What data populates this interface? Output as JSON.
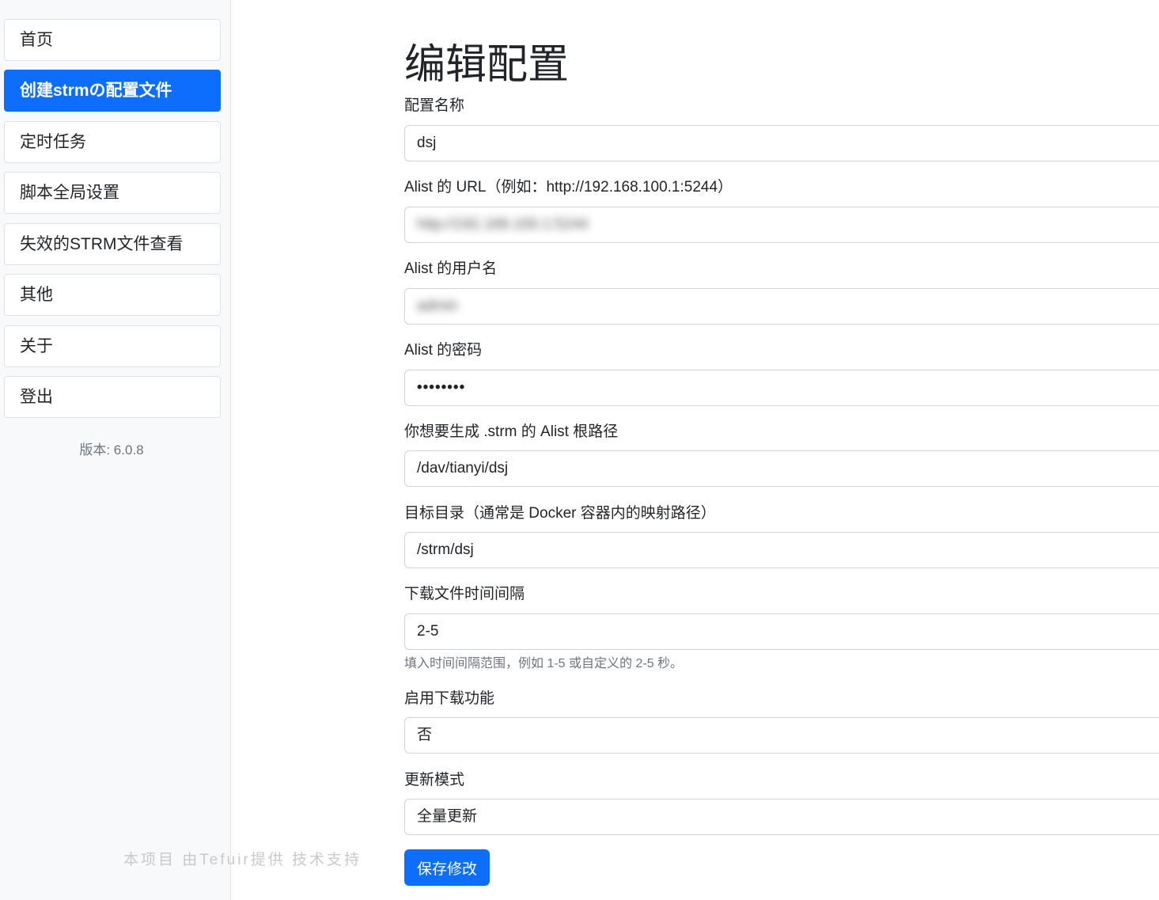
{
  "sidebar": {
    "items": [
      {
        "label": "首页",
        "active": false
      },
      {
        "label": "创建strmの配置文件",
        "active": true
      },
      {
        "label": "定时任务",
        "active": false
      },
      {
        "label": "脚本全局设置",
        "active": false
      },
      {
        "label": "失效的STRM文件查看",
        "active": false
      },
      {
        "label": "其他",
        "active": false
      },
      {
        "label": "关于",
        "active": false
      },
      {
        "label": "登出",
        "active": false
      }
    ],
    "version": "版本: 6.0.8",
    "credit": "本项目 由Tefuir提供 技术支持"
  },
  "form": {
    "title": "编辑配置",
    "fields": [
      {
        "label": "配置名称",
        "value": "dsj"
      },
      {
        "label": "Alist 的 URL（例如：http://192.168.100.1:5244）",
        "value": "http://192.168.100.1:5244",
        "blurred": true
      },
      {
        "label": "Alist 的用户名",
        "value": "admin",
        "blurred": true
      },
      {
        "label": "Alist 的密码",
        "value": "••••••••"
      },
      {
        "label": "你想要生成 .strm 的 Alist 根路径",
        "value": "/dav/tianyi/dsj"
      },
      {
        "label": "目标目录（通常是 Docker 容器内的映射路径）",
        "value": "/strm/dsj"
      },
      {
        "label": "下载文件时间间隔",
        "value": "2-5"
      },
      {
        "label": "启用下载功能",
        "value": "否"
      },
      {
        "label": "更新模式",
        "value": "全量更新"
      }
    ],
    "interval_help": "填入时间间隔范围，例如 1-5 或自定义的 2-5 秒。",
    "save_label": "保存修改"
  },
  "colors": {
    "primary": "#0d6efd",
    "sidebar_bg": "#f8f9fa",
    "border": "#ced4da",
    "muted": "#6c757d"
  }
}
